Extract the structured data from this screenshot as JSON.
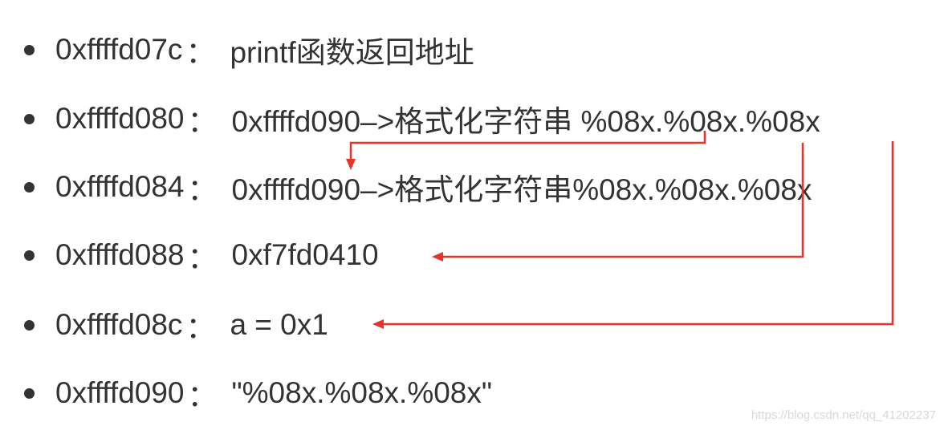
{
  "rows": [
    {
      "address": "0xffffd07c",
      "separator": "：",
      "content": "printf函数返回地址"
    },
    {
      "address": "0xffffd080",
      "separator": "：",
      "content": "0xffffd090–>格式化字符串 %08x.%08x.%08x"
    },
    {
      "address": "0xffffd084",
      "separator": "：",
      "content": "0xffffd090–>格式化字符串%08x.%08x.%08x"
    },
    {
      "address": "0xffffd088",
      "separator": "：",
      "content": "0xf7fd0410"
    },
    {
      "address": "0xffffd08c",
      "separator": "：",
      "content": "a = 0x1"
    },
    {
      "address": "0xffffd090",
      "separator": "：",
      "content": "\"%08x.%08x.%08x\""
    }
  ],
  "arrow_color": "#e8332a",
  "watermark": "https://blog.csdn.net/qq_41202237"
}
